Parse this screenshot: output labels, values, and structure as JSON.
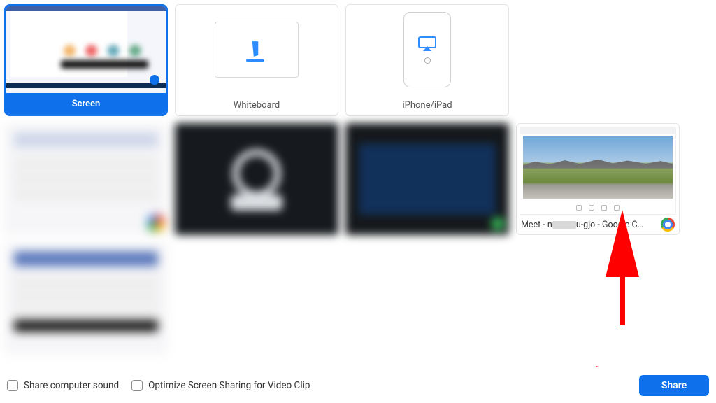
{
  "tiles": {
    "screen": {
      "label": "Screen"
    },
    "whiteboard": {
      "label": "Whiteboard"
    },
    "iphone": {
      "label": "iPhone/iPad"
    },
    "meet": {
      "label_prefix": "Meet - n",
      "label_suffix": "u-gjo - Google C…"
    }
  },
  "footer": {
    "share_sound": "Share computer sound",
    "optimize_clip": "Optimize Screen Sharing for Video Clip",
    "share_button": "Share"
  },
  "colors": {
    "accent": "#0e71eb"
  }
}
